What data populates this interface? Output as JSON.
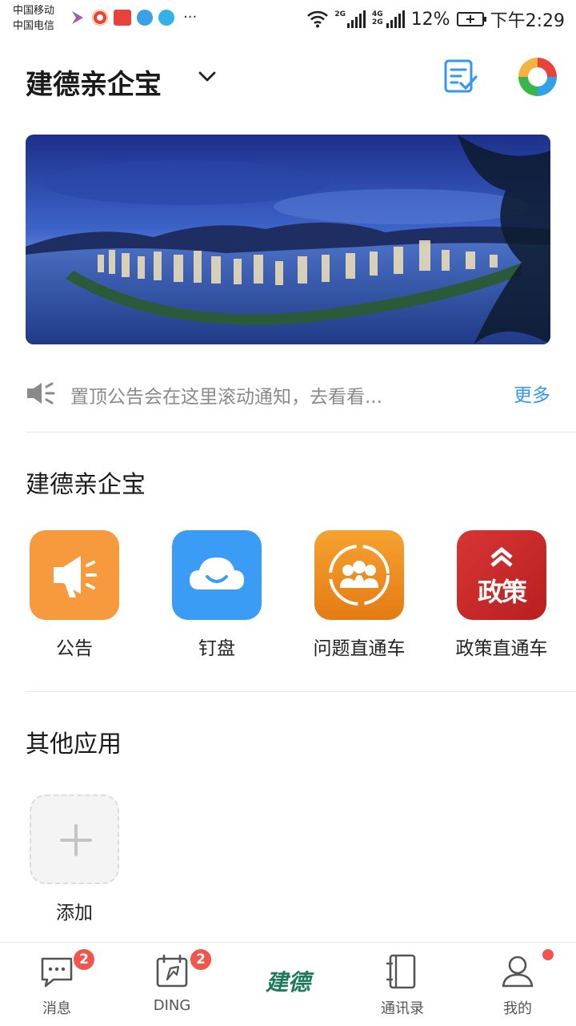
{
  "status_bar": {
    "carrier_1": "中国移动",
    "carrier_2": "中国电信",
    "more": "···",
    "signal_1_label": "2G",
    "signal_2_label_top": "4G",
    "signal_2_label_bottom": "2G",
    "battery_percent": "12%",
    "time": "下午2:29"
  },
  "header": {
    "title": "建德亲企宝",
    "logo_icon": "colorful-ring-logo-icon",
    "note_icon": "note-check-icon"
  },
  "notice": {
    "text": "置顶公告会在这里滚动通知，去看看...",
    "more": "更多"
  },
  "section_main": {
    "title": "建德亲企宝",
    "apps": [
      {
        "label": "公告",
        "icon": "megaphone-icon",
        "color": "#f79a3e"
      },
      {
        "label": "钉盘",
        "icon": "cloud-smile-icon",
        "color": "#3b9cf5"
      },
      {
        "label": "问题直通车",
        "icon": "people-cycle-icon",
        "color": "#ef8a1c"
      },
      {
        "label": "政策直通车",
        "icon": "policy-icon",
        "color": "#d12b2b",
        "tile_text": "政策"
      }
    ]
  },
  "section_other": {
    "title": "其他应用",
    "add_label": "添加"
  },
  "tabbar": {
    "tabs": [
      {
        "label": "消息",
        "badge": "2"
      },
      {
        "label": "DING",
        "badge": "2"
      },
      {
        "label": "",
        "logo_text": "建德"
      },
      {
        "label": "通讯录"
      },
      {
        "label": "我的"
      }
    ]
  },
  "colors": {
    "accent": "#3296fa",
    "badge": "#f2554b"
  }
}
